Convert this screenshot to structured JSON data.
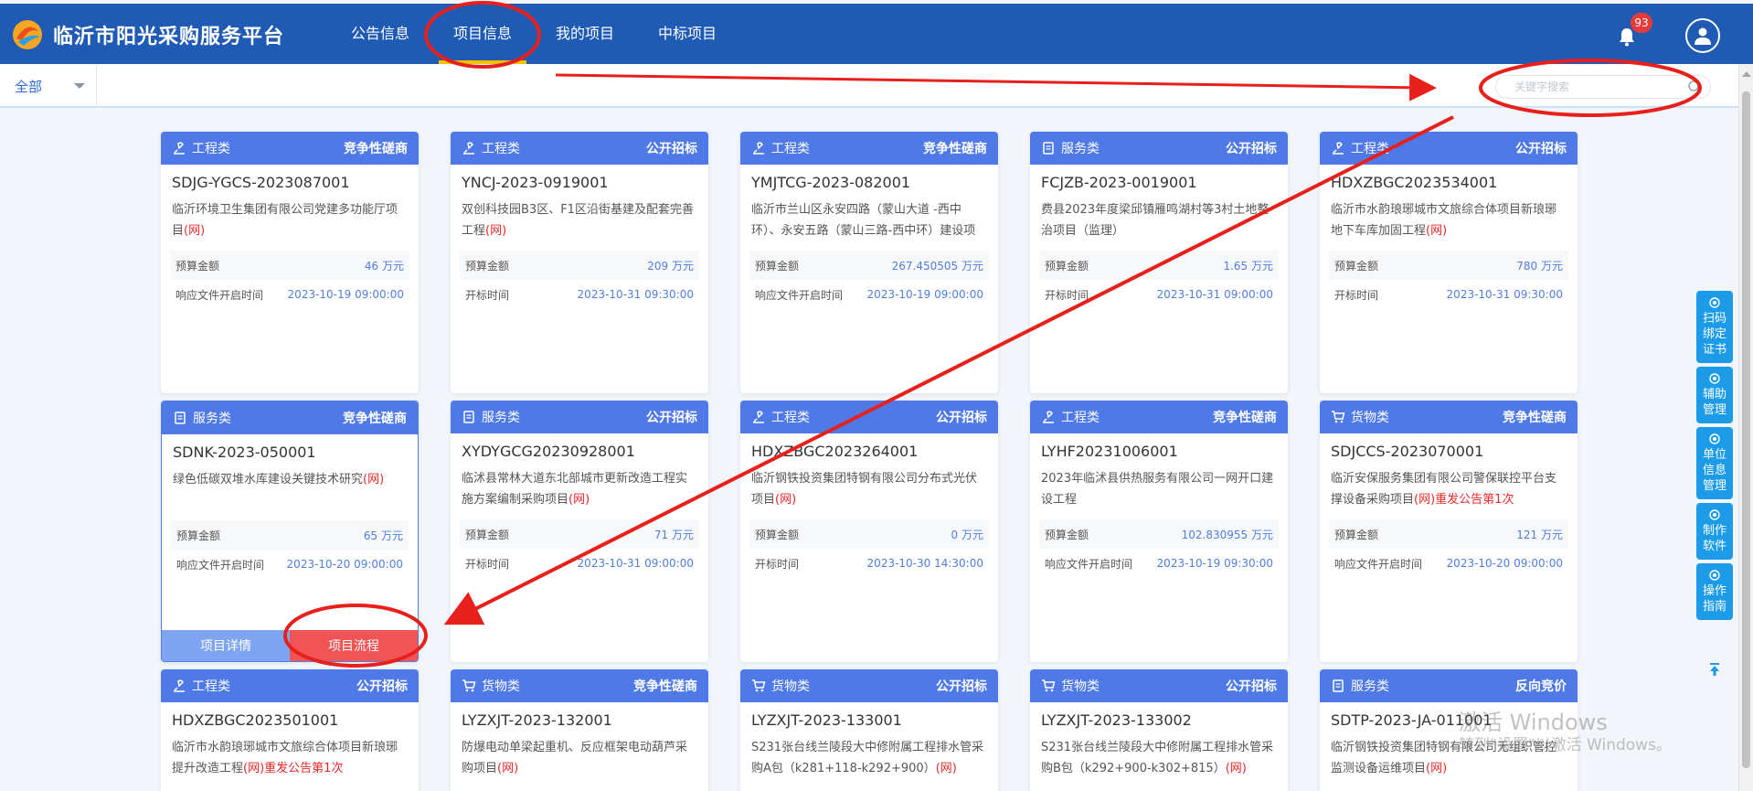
{
  "header": {
    "title": "临沂市阳光采购服务平台",
    "nav": [
      "公告信息",
      "项目信息",
      "我的项目",
      "中标项目"
    ],
    "active_nav": 1,
    "notification_count": "93"
  },
  "filter": {
    "selected": "全部",
    "search_placeholder": "关键字搜索"
  },
  "cards": [
    {
      "category": "工程类",
      "icon": "engineering-icon",
      "mode": "竞争性磋商",
      "code": "SDJG-YGCS-2023087001",
      "name": "临沂环境卫生集团有限公司党建多功能厅项目",
      "suffix": "(网)",
      "redo": "",
      "amount_label": "预算金额",
      "amount": "46 万元",
      "time_label": "响应文件开启时间",
      "time": "2023-10-19 09:00:00"
    },
    {
      "category": "工程类",
      "icon": "engineering-icon",
      "mode": "公开招标",
      "code": "YNCJ-2023-0919001",
      "name": "双创科技园B3区、F1区沿街基建及配套完善工程",
      "suffix": "(网)",
      "redo": "",
      "amount_label": "预算金额",
      "amount": "209 万元",
      "time_label": "开标时间",
      "time": "2023-10-31 09:30:00"
    },
    {
      "category": "工程类",
      "icon": "engineering-icon",
      "mode": "竞争性磋商",
      "code": "YMJTCG-2023-082001",
      "name": "临沂市兰山区永安四路（蒙山大道 -西中环）、永安五路（蒙山三路-西中环）建设项",
      "suffix": "",
      "redo": "",
      "amount_label": "预算金额",
      "amount": "267.450505 万元",
      "time_label": "响应文件开启时间",
      "time": "2023-10-19 09:00:00"
    },
    {
      "category": "服务类",
      "icon": "service-icon",
      "mode": "公开招标",
      "code": "FCJZB-2023-0019001",
      "name": "费县2023年度梁邱镇雁鸣湖村等3村土地整治项目（监理）",
      "suffix": "",
      "redo": "",
      "amount_label": "预算金额",
      "amount": "1.65 万元",
      "time_label": "开标时间",
      "time": "2023-10-31 09:00:00"
    },
    {
      "category": "工程类",
      "icon": "engineering-icon",
      "mode": "公开招标",
      "code": "HDXZBGC2023534001",
      "name": "临沂市水韵琅琊城市文旅综合体项目新琅琊地下车库加固工程",
      "suffix": "(网)",
      "redo": "",
      "amount_label": "预算金额",
      "amount": "780 万元",
      "time_label": "开标时间",
      "time": "2023-10-31 09:30:00"
    },
    {
      "category": "服务类",
      "icon": "service-icon",
      "mode": "竞争性磋商",
      "code": "SDNK-2023-050001",
      "name": "绿色低碳双堆水库建设关键技术研究",
      "suffix": "(网)",
      "redo": "",
      "amount_label": "预算金额",
      "amount": "65 万元",
      "time_label": "响应文件开启时间",
      "time": "2023-10-20 09:00:00",
      "selected": true
    },
    {
      "category": "服务类",
      "icon": "service-icon",
      "mode": "公开招标",
      "code": "XYDYGCG20230928001",
      "name": "临沭县常林大道东北部城市更新改造工程实施方案编制采购项目",
      "suffix": "(网)",
      "redo": "",
      "amount_label": "预算金额",
      "amount": "71 万元",
      "time_label": "开标时间",
      "time": "2023-10-31 09:00:00"
    },
    {
      "category": "工程类",
      "icon": "engineering-icon",
      "mode": "公开招标",
      "code": "HDXZBGC2023264001",
      "name": "临沂钢铁投资集团特钢有限公司分布式光伏项目",
      "suffix": "(网)",
      "redo": "",
      "amount_label": "预算金额",
      "amount": "0 万元",
      "time_label": "开标时间",
      "time": "2023-10-30 14:30:00"
    },
    {
      "category": "工程类",
      "icon": "engineering-icon",
      "mode": "竞争性磋商",
      "code": "LYHF20231006001",
      "name": "2023年临沭县供热服务有限公司一网开口建设工程",
      "suffix": "",
      "redo": "",
      "amount_label": "预算金额",
      "amount": "102.830955 万元",
      "time_label": "响应文件开启时间",
      "time": "2023-10-19 09:30:00"
    },
    {
      "category": "货物类",
      "icon": "cart-icon",
      "mode": "竞争性磋商",
      "code": "SDJCCS-2023070001",
      "name": "临沂安保服务集团有限公司警保联控平台支撑设备采购项目",
      "suffix": "(网)",
      "redo": "重发公告第1次",
      "amount_label": "预算金额",
      "amount": "121 万元",
      "time_label": "响应文件开启时间",
      "time": "2023-10-20 09:00:00"
    },
    {
      "category": "工程类",
      "icon": "engineering-icon",
      "mode": "公开招标",
      "code": "HDXZBGC2023501001",
      "name": "临沂市水韵琅琊城市文旅综合体项目新琅琊提升改造工程",
      "suffix": "(网)",
      "redo": "重发公告第1次",
      "amount_label": "",
      "amount": "",
      "time_label": "",
      "time": ""
    },
    {
      "category": "货物类",
      "icon": "cart-icon",
      "mode": "竞争性磋商",
      "code": "LYZXJT-2023-132001",
      "name": "防爆电动单梁起重机、反应框架电动葫芦采购项目",
      "suffix": "(网)",
      "redo": "",
      "amount_label": "",
      "amount": "",
      "time_label": "",
      "time": ""
    },
    {
      "category": "货物类",
      "icon": "cart-icon",
      "mode": "公开招标",
      "code": "LYZXJT-2023-133001",
      "name": "S231张台线兰陵段大中修附属工程排水管采购A包（k281+118-k292+900）",
      "suffix": "(网)",
      "redo": "",
      "amount_label": "",
      "amount": "",
      "time_label": "",
      "time": ""
    },
    {
      "category": "货物类",
      "icon": "cart-icon",
      "mode": "公开招标",
      "code": "LYZXJT-2023-133002",
      "name": "S231张台线兰陵段大中修附属工程排水管采购B包（k292+900-k302+815）",
      "suffix": "(网)",
      "redo": "",
      "amount_label": "",
      "amount": "",
      "time_label": "",
      "time": ""
    },
    {
      "category": "服务类",
      "icon": "service-icon",
      "mode": "反向竞价",
      "code": "SDTP-2023-JA-011001",
      "name": "临沂钢铁投资集团特钢有限公司无组织管控监测设备运维项目",
      "suffix": "(网)",
      "redo": "",
      "amount_label": "",
      "amount": "",
      "time_label": "",
      "time": ""
    }
  ],
  "card_actions": {
    "detail": "项目详情",
    "flow": "项目流程"
  },
  "side_tools": [
    "扫码\n绑定\n证书",
    "辅助\n管理",
    "单位\n信息\n管理",
    "制作\n软件",
    "操作\n指南"
  ],
  "watermark": {
    "line1": "激活 Windows",
    "line2": "转到\"设置\"以激活 Windows。"
  },
  "colors": {
    "header": "#1f5bb4",
    "card_head": "#4e79e6",
    "accent": "#4f7ee0",
    "red": "#e92828",
    "annotation": "#e8201c",
    "tool": "#1c9ce8"
  }
}
